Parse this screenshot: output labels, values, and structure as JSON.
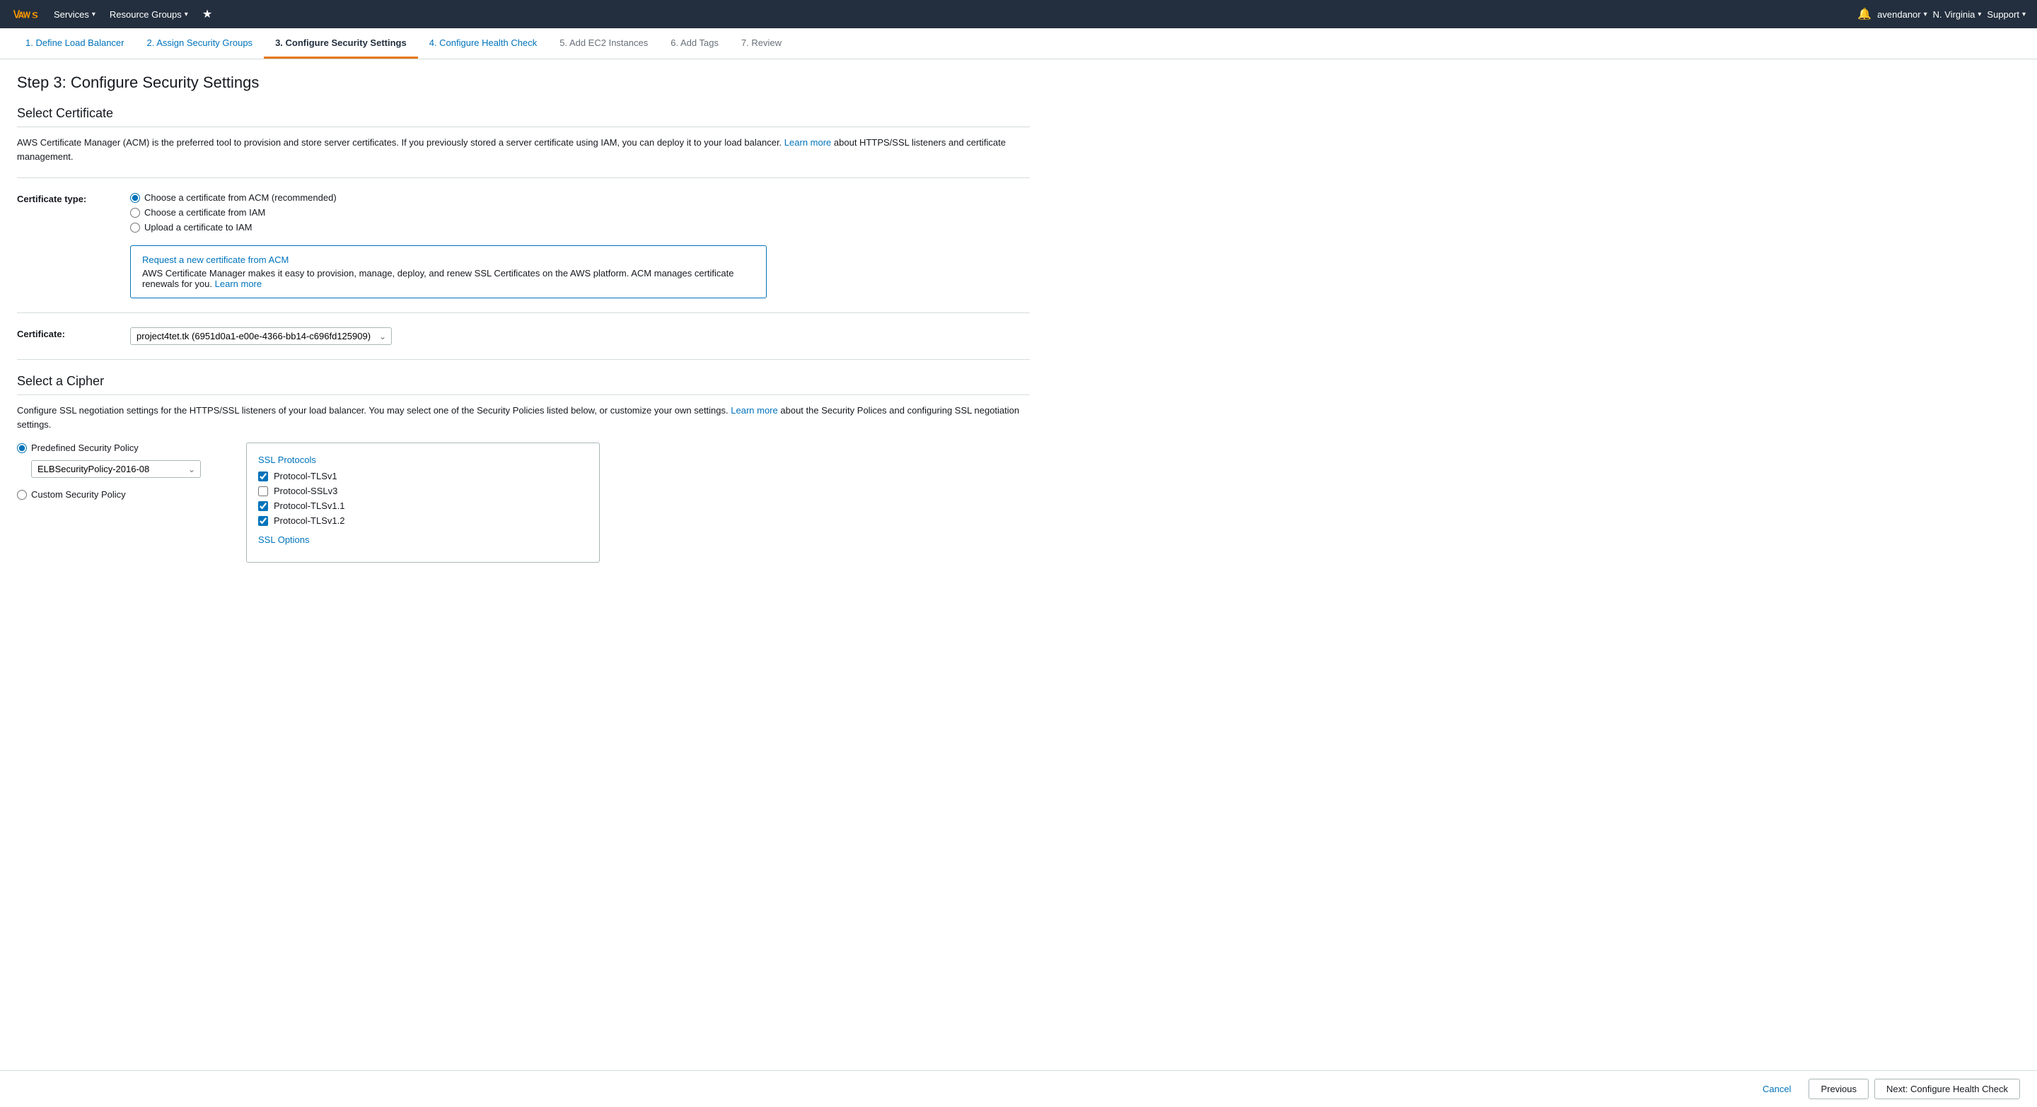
{
  "nav": {
    "services_label": "Services",
    "resource_groups_label": "Resource Groups",
    "user": "avendanor",
    "region": "N. Virginia",
    "support": "Support"
  },
  "wizard": {
    "tabs": [
      {
        "id": "step1",
        "label": "1. Define Load Balancer",
        "state": "inactive"
      },
      {
        "id": "step2",
        "label": "2. Assign Security Groups",
        "state": "inactive"
      },
      {
        "id": "step3",
        "label": "3. Configure Security Settings",
        "state": "active"
      },
      {
        "id": "step4",
        "label": "4. Configure Health Check",
        "state": "inactive"
      },
      {
        "id": "step5",
        "label": "5. Add EC2 Instances",
        "state": "disabled"
      },
      {
        "id": "step6",
        "label": "6. Add Tags",
        "state": "disabled"
      },
      {
        "id": "step7",
        "label": "7. Review",
        "state": "disabled"
      }
    ]
  },
  "page": {
    "title": "Step 3: Configure Security Settings",
    "certificate_section_title": "Select Certificate",
    "certificate_description": "AWS Certificate Manager (ACM) is the preferred tool to provision and store server certificates. If you previously stored a server certificate using IAM, you can deploy it to your load balancer.",
    "certificate_description_link": "Learn more",
    "certificate_description_suffix": "about HTTPS/SSL listeners and certificate management.",
    "cert_type_label": "Certificate type:",
    "cert_option_acm": "Choose a certificate from ACM (recommended)",
    "cert_option_iam": "Choose a certificate from IAM",
    "cert_option_upload": "Upload a certificate to IAM",
    "info_box_link": "Request a new certificate from ACM",
    "info_box_text": "AWS Certificate Manager makes it easy to provision, manage, deploy, and renew SSL Certificates on the AWS platform. ACM manages certificate renewals for you.",
    "info_box_link2": "Learn more",
    "cert_label": "Certificate:",
    "cert_value": "project4tet.tk (6951d0a1-e00e-4366-bb14-c696fd125909)",
    "cipher_section_title": "Select a Cipher",
    "cipher_description": "Configure SSL negotiation settings for the HTTPS/SSL listeners of your load balancer. You may select one of the Security Policies listed below, or customize your own settings.",
    "cipher_description_link": "Learn more",
    "cipher_description_suffix": "about the Security Polices and configuring SSL negotiation settings.",
    "predefined_label": "Predefined Security Policy",
    "predefined_value": "ELBSecurityPolicy-2016-08",
    "custom_label": "Custom Security Policy",
    "ssl_protocols_title": "SSL Protocols",
    "protocols": [
      {
        "label": "Protocol-TLSv1",
        "checked": true,
        "enabled": true
      },
      {
        "label": "Protocol-SSLv3",
        "checked": false,
        "enabled": true
      },
      {
        "label": "Protocol-TLSv1.1",
        "checked": true,
        "enabled": true
      },
      {
        "label": "Protocol-TLSv1.2",
        "checked": true,
        "enabled": true
      }
    ],
    "ssl_options_title": "SSL Options"
  },
  "footer": {
    "cancel_label": "Cancel",
    "previous_label": "Previous",
    "next_label": "Next: Configure Health Check"
  }
}
